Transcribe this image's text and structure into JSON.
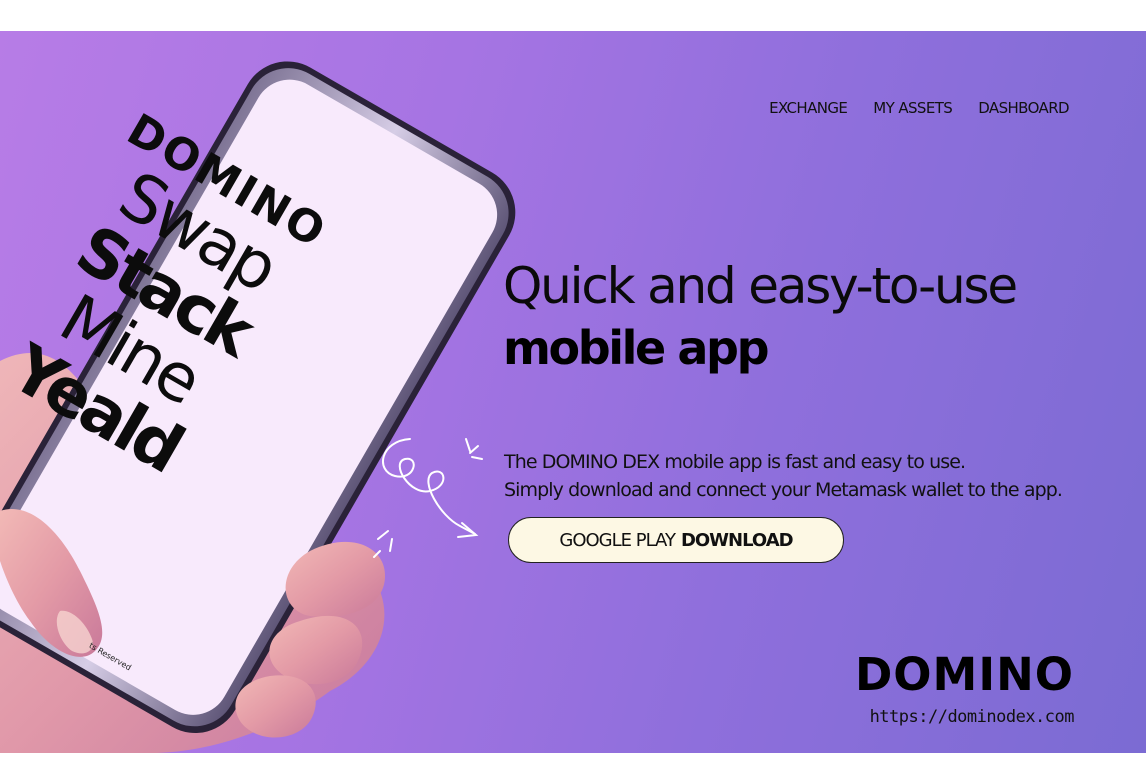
{
  "nav": {
    "items": [
      {
        "label": "EXCHANGE"
      },
      {
        "label": "MY ASSETS"
      },
      {
        "label": "DASHBOARD"
      }
    ]
  },
  "hero": {
    "title_line1": "Quick and easy-to-use",
    "title_line2": "mobile app",
    "description_line1": "The DOMINO DEX mobile app is fast and easy to use.",
    "description_line2": "Simply download and connect your Metamask wallet to the app.",
    "cta_prefix": "GOOGLE PLAY",
    "cta_bold": "DOWNLOAD"
  },
  "phone": {
    "logo": "DOMINO",
    "words": [
      "Swap",
      "Stack",
      "Mine",
      "Yeald"
    ],
    "footer": "ts Reserved"
  },
  "brand": {
    "logo": "DOMINO",
    "url": "https://dominodex.com"
  },
  "colors": {
    "gradient_start": "#b77ce6",
    "gradient_end": "#7b6bd3",
    "button_fill": "#fdf8e4",
    "phone_screen": "#f8eafc"
  }
}
